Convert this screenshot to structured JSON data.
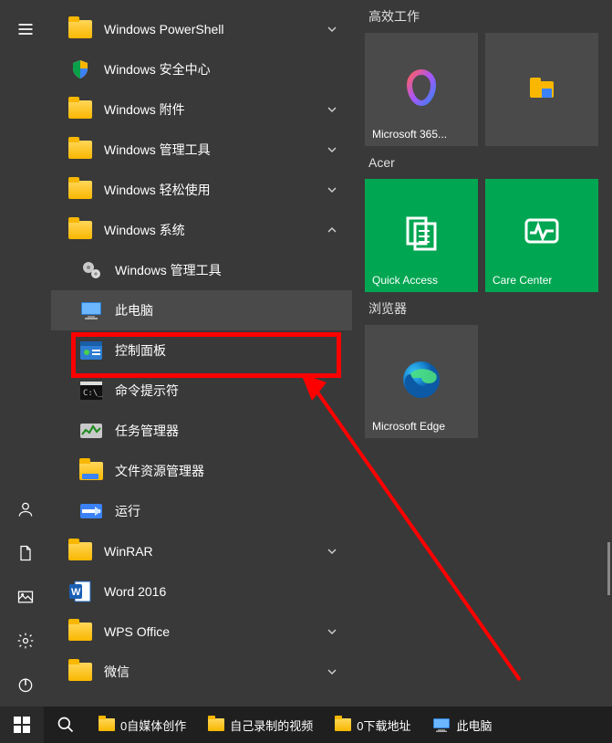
{
  "apps": [
    {
      "label": "Windows PowerShell",
      "type": "folder",
      "exp": "down"
    },
    {
      "label": "Windows 安全中心",
      "type": "shield"
    },
    {
      "label": "Windows 附件",
      "type": "folder",
      "exp": "down"
    },
    {
      "label": "Windows 管理工具",
      "type": "folder",
      "exp": "down"
    },
    {
      "label": "Windows 轻松使用",
      "type": "folder",
      "exp": "down"
    },
    {
      "label": "Windows 系统",
      "type": "folder",
      "exp": "up"
    },
    {
      "label": "Windows 管理工具",
      "type": "admin-tools",
      "sub": true
    },
    {
      "label": "此电脑",
      "type": "this-pc",
      "sub": true,
      "hover": true
    },
    {
      "label": "控制面板",
      "type": "control-panel",
      "sub": true,
      "highlight": true
    },
    {
      "label": "命令提示符",
      "type": "cmd",
      "sub": true
    },
    {
      "label": "任务管理器",
      "type": "taskmgr",
      "sub": true
    },
    {
      "label": "文件资源管理器",
      "type": "explorer",
      "sub": true
    },
    {
      "label": "运行",
      "type": "run",
      "sub": true
    },
    {
      "label": "WinRAR",
      "type": "folder",
      "exp": "down"
    },
    {
      "label": "Word 2016",
      "type": "word"
    },
    {
      "label": "WPS Office",
      "type": "folder",
      "exp": "down"
    },
    {
      "label": "微信",
      "type": "folder",
      "exp": "down"
    }
  ],
  "tileGroups": [
    {
      "header": "高效工作",
      "tiles": [
        {
          "label": "Microsoft 365...",
          "kind": "m365",
          "color": "gray"
        },
        {
          "label": "",
          "kind": "store-folder",
          "color": "gray"
        }
      ]
    },
    {
      "header": "Acer",
      "tiles": [
        {
          "label": "Quick Access",
          "kind": "quick-access",
          "color": "green"
        },
        {
          "label": "Care Center",
          "kind": "care-center",
          "color": "green"
        }
      ]
    },
    {
      "header": "浏览器",
      "tiles": [
        {
          "label": "Microsoft Edge",
          "kind": "edge",
          "color": "gray"
        }
      ]
    }
  ],
  "taskbar": [
    {
      "label": "0自媒体创作",
      "icon": "folder"
    },
    {
      "label": "自己录制的视频",
      "icon": "folder"
    },
    {
      "label": "0下载地址",
      "icon": "folder"
    },
    {
      "label": "此电脑",
      "icon": "this-pc"
    }
  ]
}
